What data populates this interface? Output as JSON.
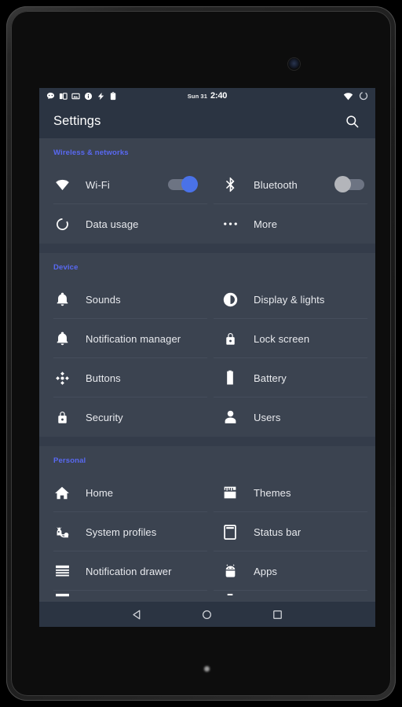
{
  "status_bar": {
    "date": "Sun 31",
    "time": "2:40",
    "left_icons": [
      "message-icon",
      "sim-card-icon",
      "screenshot-icon",
      "info-icon",
      "usb-charge-icon",
      "clipboard-icon"
    ],
    "right_icons": [
      "wifi-icon",
      "battery-ring-icon"
    ]
  },
  "toolbar": {
    "title": "Settings",
    "search_icon": "search-icon"
  },
  "colors": {
    "accent_blue": "#5969f2",
    "toggle_on": "#4a72e8",
    "toggle_off": "#b3b5ba",
    "card_bg": "#3b4350",
    "page_bg": "#343c4a",
    "toolbar_bg": "#2b3442"
  },
  "sections": [
    {
      "title": "Wireless & networks",
      "items": [
        {
          "label": "Wi-Fi",
          "icon": "wifi-icon",
          "control": "toggle",
          "toggle_state": "on"
        },
        {
          "label": "Bluetooth",
          "icon": "bluetooth-icon",
          "control": "toggle",
          "toggle_state": "off"
        },
        {
          "label": "Data usage",
          "icon": "data-usage-icon",
          "control": "none"
        },
        {
          "label": "More",
          "icon": "more-dots-icon",
          "control": "none"
        }
      ]
    },
    {
      "title": "Device",
      "items": [
        {
          "label": "Sounds",
          "icon": "bell-icon",
          "control": "none"
        },
        {
          "label": "Display & lights",
          "icon": "brightness-icon",
          "control": "none"
        },
        {
          "label": "Notification manager",
          "icon": "bell-icon",
          "control": "none"
        },
        {
          "label": "Lock screen",
          "icon": "lock-icon",
          "control": "none"
        },
        {
          "label": "Buttons",
          "icon": "dpad-icon",
          "control": "none"
        },
        {
          "label": "Battery",
          "icon": "battery-icon",
          "control": "none"
        },
        {
          "label": "Security",
          "icon": "lock-icon",
          "control": "none"
        },
        {
          "label": "Users",
          "icon": "person-icon",
          "control": "none"
        }
      ]
    },
    {
      "title": "Personal",
      "items": [
        {
          "label": "Home",
          "icon": "home-icon",
          "control": "none"
        },
        {
          "label": "Themes",
          "icon": "themes-icon",
          "control": "none"
        },
        {
          "label": "System profiles",
          "icon": "system-profiles-icon",
          "control": "none"
        },
        {
          "label": "Status bar",
          "icon": "status-bar-icon",
          "control": "none"
        },
        {
          "label": "Notification drawer",
          "icon": "notification-drawer-icon",
          "control": "none"
        },
        {
          "label": "Apps",
          "icon": "android-apps-icon",
          "control": "none"
        }
      ]
    }
  ],
  "nav_bar": {
    "back": "back-triangle-icon",
    "home": "home-circle-icon",
    "recents": "recents-square-icon"
  }
}
